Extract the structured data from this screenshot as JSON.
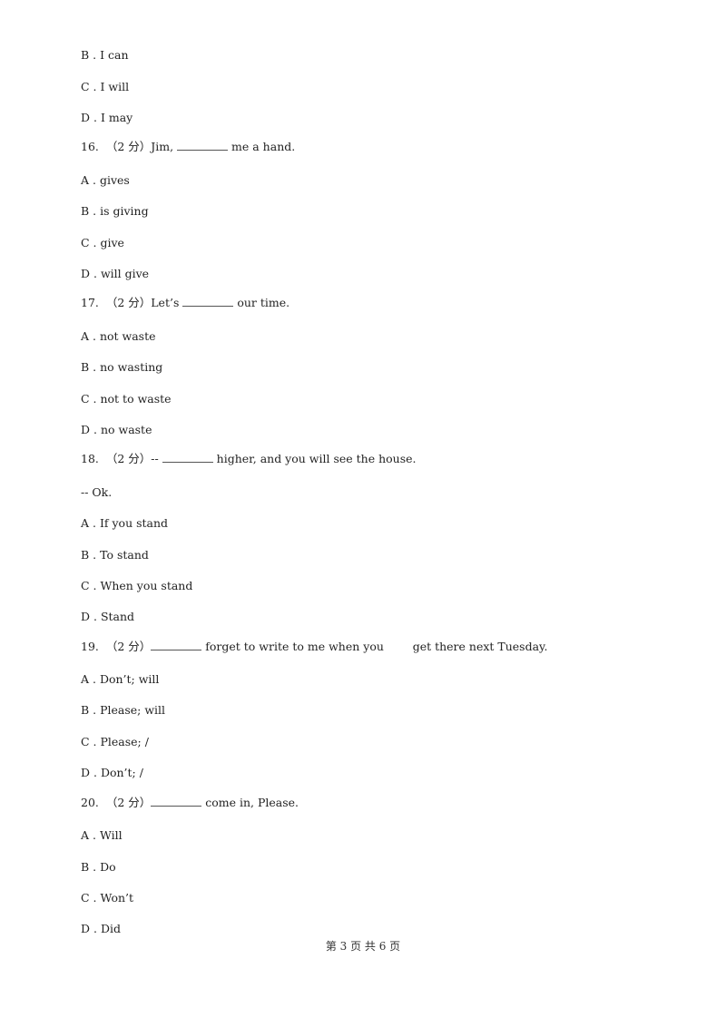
{
  "lines": [
    {
      "type": "option",
      "text": "B . I can"
    },
    {
      "type": "option",
      "text": "C . I will"
    },
    {
      "type": "option",
      "text": "D . I may"
    },
    {
      "type": "question",
      "pre": "16.  （2 分）Jim, ",
      "blank": true,
      "post": " me a hand."
    },
    {
      "type": "option",
      "text": "A . gives"
    },
    {
      "type": "option",
      "text": "B . is giving"
    },
    {
      "type": "option",
      "text": "C . give"
    },
    {
      "type": "option",
      "text": "D . will give"
    },
    {
      "type": "question",
      "pre": "17.  （2 分）Let’s ",
      "blank": true,
      "post": " our time."
    },
    {
      "type": "option",
      "text": "A . not waste"
    },
    {
      "type": "option",
      "text": "B . no wasting"
    },
    {
      "type": "option",
      "text": "C . not to waste"
    },
    {
      "type": "option",
      "text": "D . no waste"
    },
    {
      "type": "question",
      "pre": "18.  （2 分）-- ",
      "blank": true,
      "post": " higher, and you will see the house."
    },
    {
      "type": "option",
      "text": "-- Ok."
    },
    {
      "type": "option",
      "text": "A . If you stand"
    },
    {
      "type": "option",
      "text": "B . To stand"
    },
    {
      "type": "option",
      "text": "C . When you stand"
    },
    {
      "type": "option",
      "text": "D . Stand"
    },
    {
      "type": "question",
      "pre": "19.  （2 分）",
      "blank": true,
      "post": " forget to write to me when you        get there next Tuesday."
    },
    {
      "type": "option",
      "text": "A . Don’t; will"
    },
    {
      "type": "option",
      "text": "B . Please; will"
    },
    {
      "type": "option",
      "text": "C . Please; /"
    },
    {
      "type": "option",
      "text": "D . Don’t; /"
    },
    {
      "type": "question",
      "pre": "20.  （2 分）",
      "blank": true,
      "post": " come in, Please."
    },
    {
      "type": "option",
      "text": "A . Will"
    },
    {
      "type": "option",
      "text": "B . Do"
    },
    {
      "type": "option",
      "text": "C . Won’t"
    },
    {
      "type": "option",
      "text": "D . Did"
    }
  ],
  "footer": "第 3 页 共 6 页"
}
